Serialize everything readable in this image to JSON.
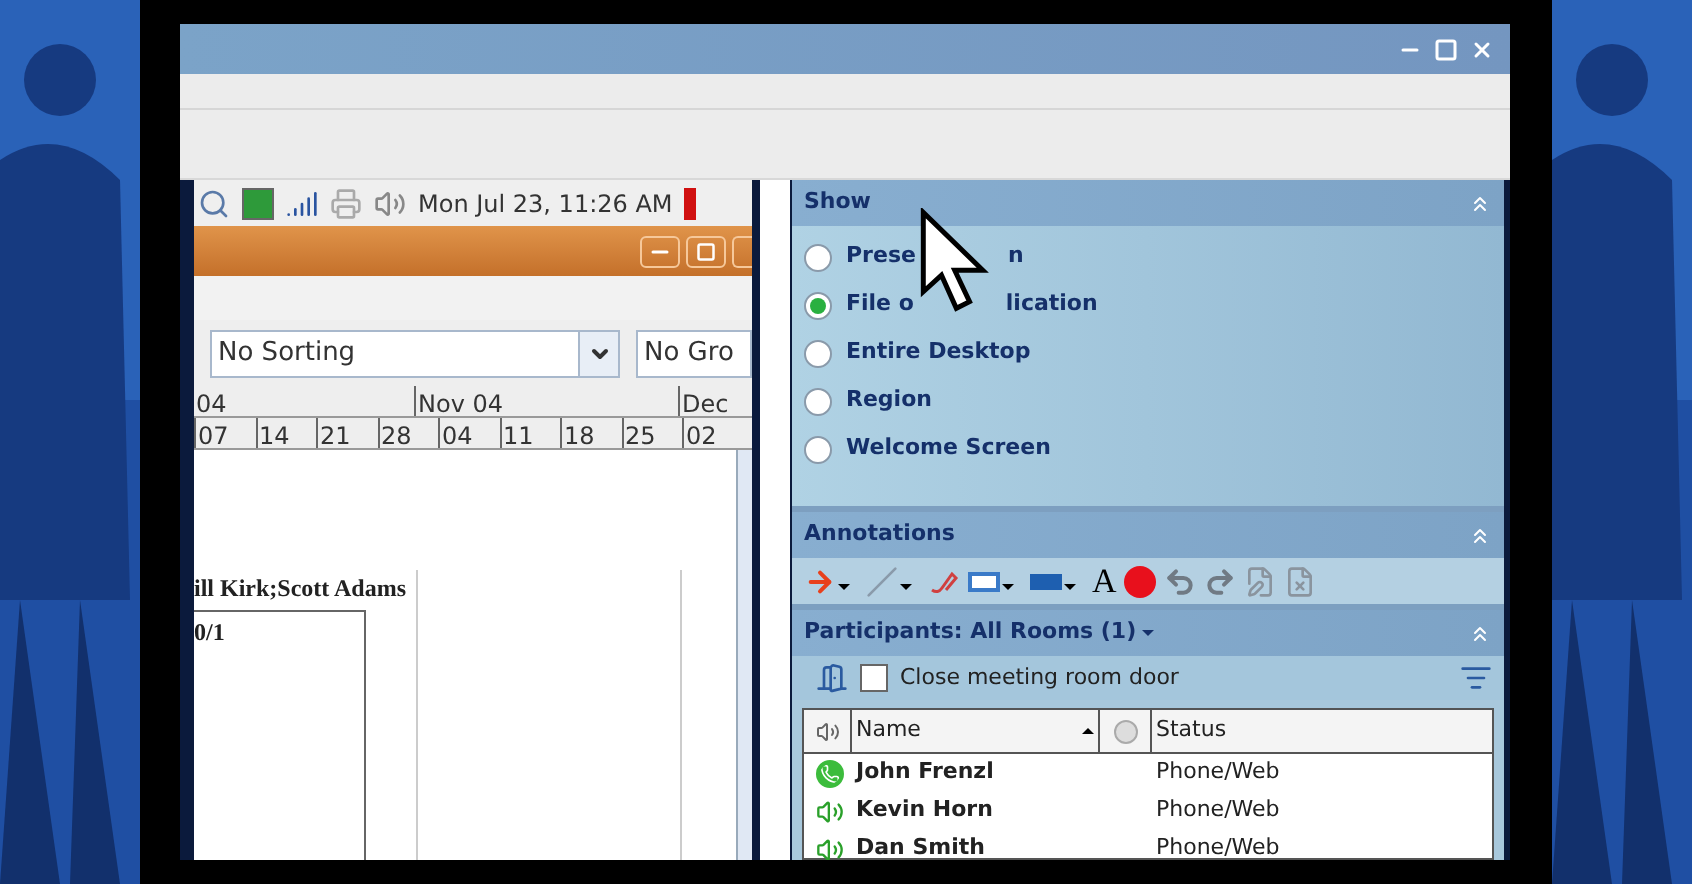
{
  "desktop": {
    "clock": "Mon Jul 23, 11:26 AM",
    "sort_combo": {
      "value": "No Sorting"
    },
    "group_combo": {
      "value": "No Gro"
    },
    "timeline": {
      "months": [
        "04",
        "Nov 04",
        "Dec"
      ],
      "days": [
        "07",
        "14",
        "21",
        "28",
        "04",
        "11",
        "18",
        "25",
        "02"
      ]
    },
    "task_label": "ill Kirk;Scott Adams",
    "task_progress": "0/1"
  },
  "show": {
    "title": "Show",
    "options": [
      {
        "parts": [
          "Prese",
          "n"
        ],
        "selected": false
      },
      {
        "parts": [
          "File o",
          "lication"
        ],
        "selected": true
      },
      {
        "parts": [
          "Entire Desktop"
        ],
        "selected": false
      },
      {
        "parts": [
          "Region"
        ],
        "selected": false
      },
      {
        "parts": [
          "Welcome Screen"
        ],
        "selected": false
      }
    ]
  },
  "annotations": {
    "title": "Annotations",
    "tools": [
      {
        "kind": "arrow",
        "menu": true
      },
      {
        "kind": "line",
        "menu": true
      },
      {
        "kind": "eraser",
        "menu": false
      },
      {
        "kind": "rect",
        "menu": true
      },
      {
        "kind": "fill",
        "menu": true
      },
      {
        "kind": "text",
        "label": "A",
        "menu": false
      },
      {
        "kind": "record",
        "menu": false
      },
      {
        "kind": "undo",
        "menu": false
      },
      {
        "kind": "redo",
        "menu": false
      },
      {
        "kind": "edit",
        "menu": false
      },
      {
        "kind": "clear",
        "menu": false
      }
    ]
  },
  "participants": {
    "title": "Participants: All Rooms (1)",
    "close_door": {
      "label": "Close meeting room door",
      "checked": false
    },
    "columns": [
      "Name",
      "Status"
    ],
    "rows": [
      {
        "name": "John Frenzl",
        "status": "Phone/Web",
        "kind": "phone"
      },
      {
        "name": "Kevin Horn",
        "status": "Phone/Web",
        "kind": "speaker"
      },
      {
        "name": "Dan Smith",
        "status": "Phone/Web",
        "kind": "speaker"
      }
    ]
  }
}
